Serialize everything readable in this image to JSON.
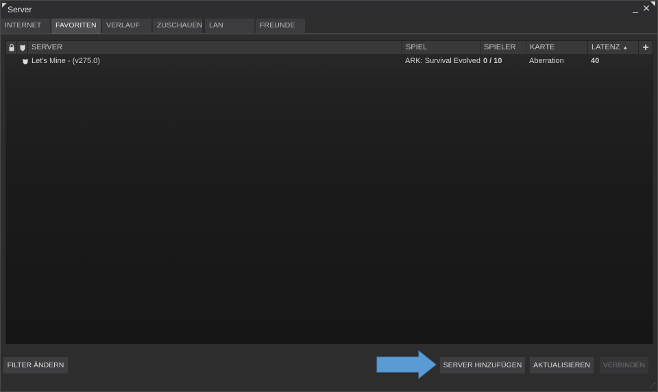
{
  "window": {
    "title": "Server",
    "minimize_label": "_",
    "close_label": "✕"
  },
  "tabs": [
    {
      "label": "INTERNET",
      "active": false
    },
    {
      "label": "FAVORITEN",
      "active": true
    },
    {
      "label": "VERLAUF",
      "active": false
    },
    {
      "label": "ZUSCHAUEN",
      "active": false
    },
    {
      "label": "LAN",
      "active": false
    },
    {
      "label": "FREUNDE",
      "active": false
    }
  ],
  "columns": {
    "lock_icon": "lock-icon",
    "vac_icon": "shield-icon",
    "server": "SERVER",
    "game": "SPIEL",
    "players": "SPIELER",
    "map": "KARTE",
    "latency": "LATENZ",
    "latency_sort": "ascending",
    "add_column": "+"
  },
  "servers": [
    {
      "secure_icon": "shield-icon",
      "name": "Let's Mine - (v275.0)",
      "game": "ARK: Survival Evolved",
      "players": "0 / 10",
      "map": "Aberration",
      "latency": "40"
    }
  ],
  "buttons": {
    "filter": "FILTER ÄNDERN",
    "add_server": "SERVER HINZUFÜGEN",
    "refresh": "AKTUALISIEREN",
    "connect": "VERBINDEN"
  },
  "colors": {
    "annotation_arrow": "#5b9bd5",
    "background": "#2d2d2e"
  }
}
